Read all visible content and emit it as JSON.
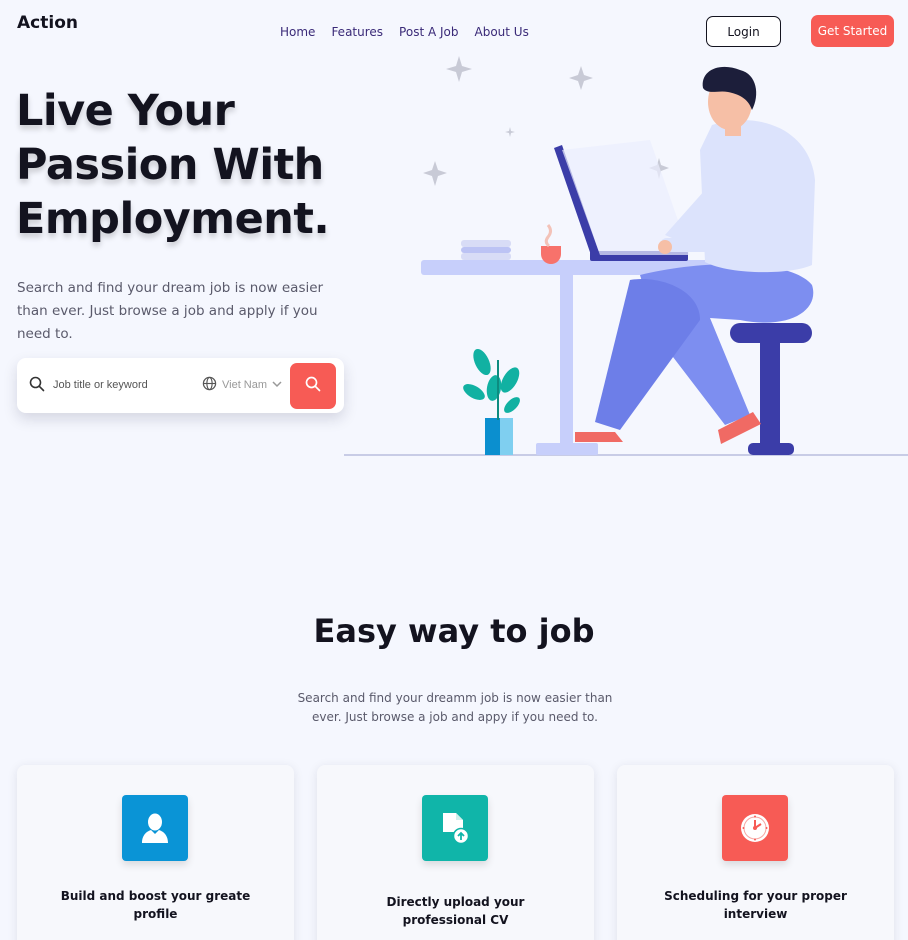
{
  "brand": {
    "name": "Action"
  },
  "nav": {
    "items": [
      {
        "label": "Home"
      },
      {
        "label": "Features"
      },
      {
        "label": "Post A Job"
      },
      {
        "label": "About Us"
      }
    ]
  },
  "header": {
    "login_label": "Login",
    "get_started_label": "Get Started"
  },
  "hero": {
    "title_line1": "Live Your",
    "title_line2": "Passion With",
    "title_line3": "Employment.",
    "subtitle": "Search and find your dream job is now easier than ever. Just browse a job and apply if you need to."
  },
  "search": {
    "placeholder": "Job title or keyword",
    "location": "Viet Nam",
    "icon": "search-icon",
    "location_icon": "globe-icon"
  },
  "features": {
    "title": "Easy way to job",
    "subtitle": "Search and find your dreamm job is now easier than ever. Just browse a job and appy if you need to.",
    "cards": [
      {
        "label": "Build and boost your greate profile",
        "icon": "user-icon",
        "color": "#0a94d6"
      },
      {
        "label": "Directly upload your professional CV",
        "icon": "upload-file-icon",
        "color": "#10b5a9"
      },
      {
        "label": "Scheduling for your proper interview",
        "icon": "clock-icon",
        "color": "#f75b55"
      }
    ]
  },
  "colors": {
    "accent": "#f75b55",
    "background": "#f5f7fe",
    "nav_text": "#3a2a78"
  }
}
